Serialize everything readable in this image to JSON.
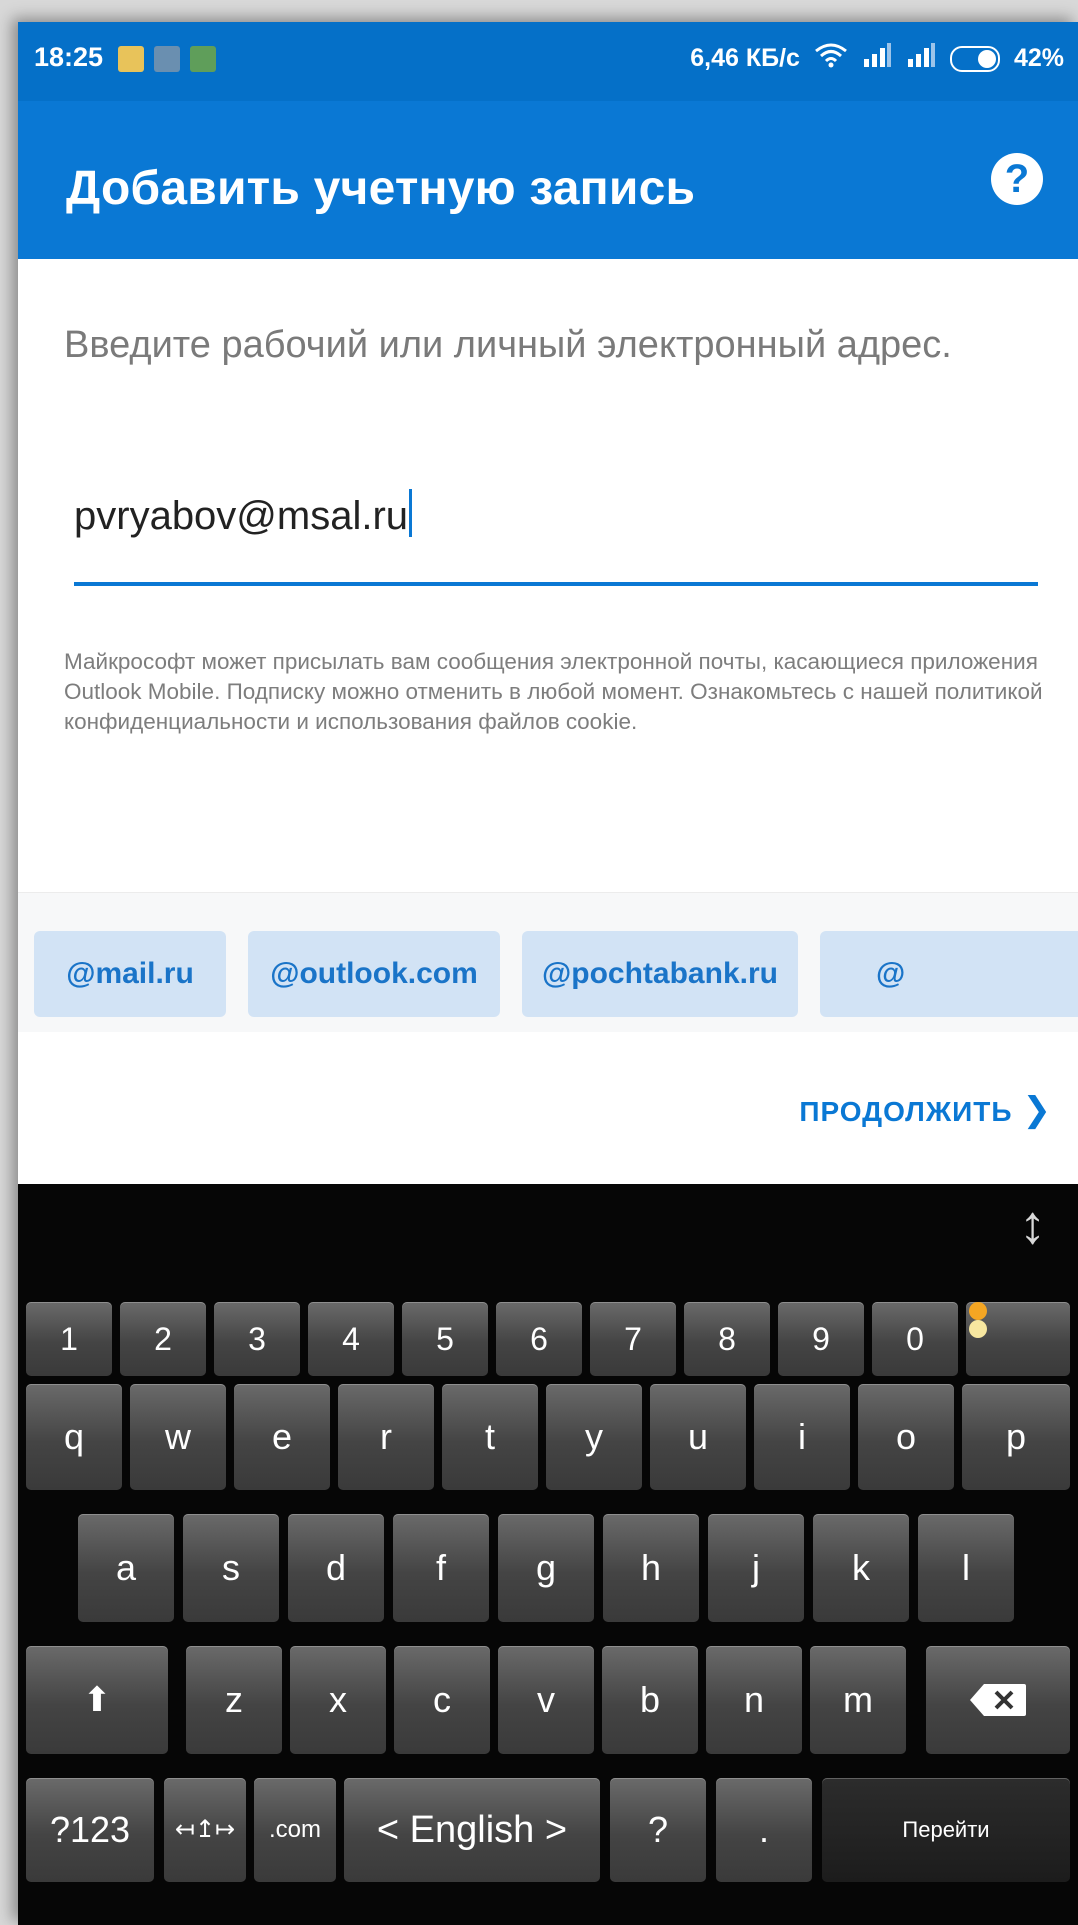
{
  "status_bar": {
    "time": "18:25",
    "speed": "6,46 КБ/с",
    "battery": "42%"
  },
  "app_bar": {
    "title": "Добавить учетную запись",
    "help_icon": "?"
  },
  "form": {
    "prompt": "Введите рабочий или личный электронный адрес.",
    "email_value": "pvryabov@msal.ru",
    "disclaimer": "Майкрософт может присылать вам сообщения электронной почты, касающиеся приложения Outlook Mobile. Подписку можно отменить в любой момент. Ознакомьтесь с нашей политикой конфиденциальности и использования файлов cookie."
  },
  "suggestions": [
    "@mail.ru",
    "@outlook.com",
    "@pochtabank.ru",
    "@"
  ],
  "continue_label": "ПРОДОЛЖИТЬ",
  "keyboard": {
    "number_row": [
      "1",
      "2",
      "3",
      "4",
      "5",
      "6",
      "7",
      "8",
      "9",
      "0"
    ],
    "row1": [
      "q",
      "w",
      "e",
      "r",
      "t",
      "y",
      "u",
      "i",
      "o",
      "p"
    ],
    "row2": [
      "a",
      "s",
      "d",
      "f",
      "g",
      "h",
      "j",
      "k",
      "l"
    ],
    "row3": [
      "z",
      "x",
      "c",
      "v",
      "b",
      "n",
      "m"
    ],
    "mode_key": "?123",
    "com_key": ".com",
    "language_key": "< English >",
    "question_key": "?",
    "period_key": ".",
    "go_key": "Перейти"
  },
  "colors": {
    "status_bar": "#0570c8",
    "app_bar": "#0a78d4",
    "chip_bg": "#d2e3f5",
    "chip_text": "#1a74c8"
  }
}
